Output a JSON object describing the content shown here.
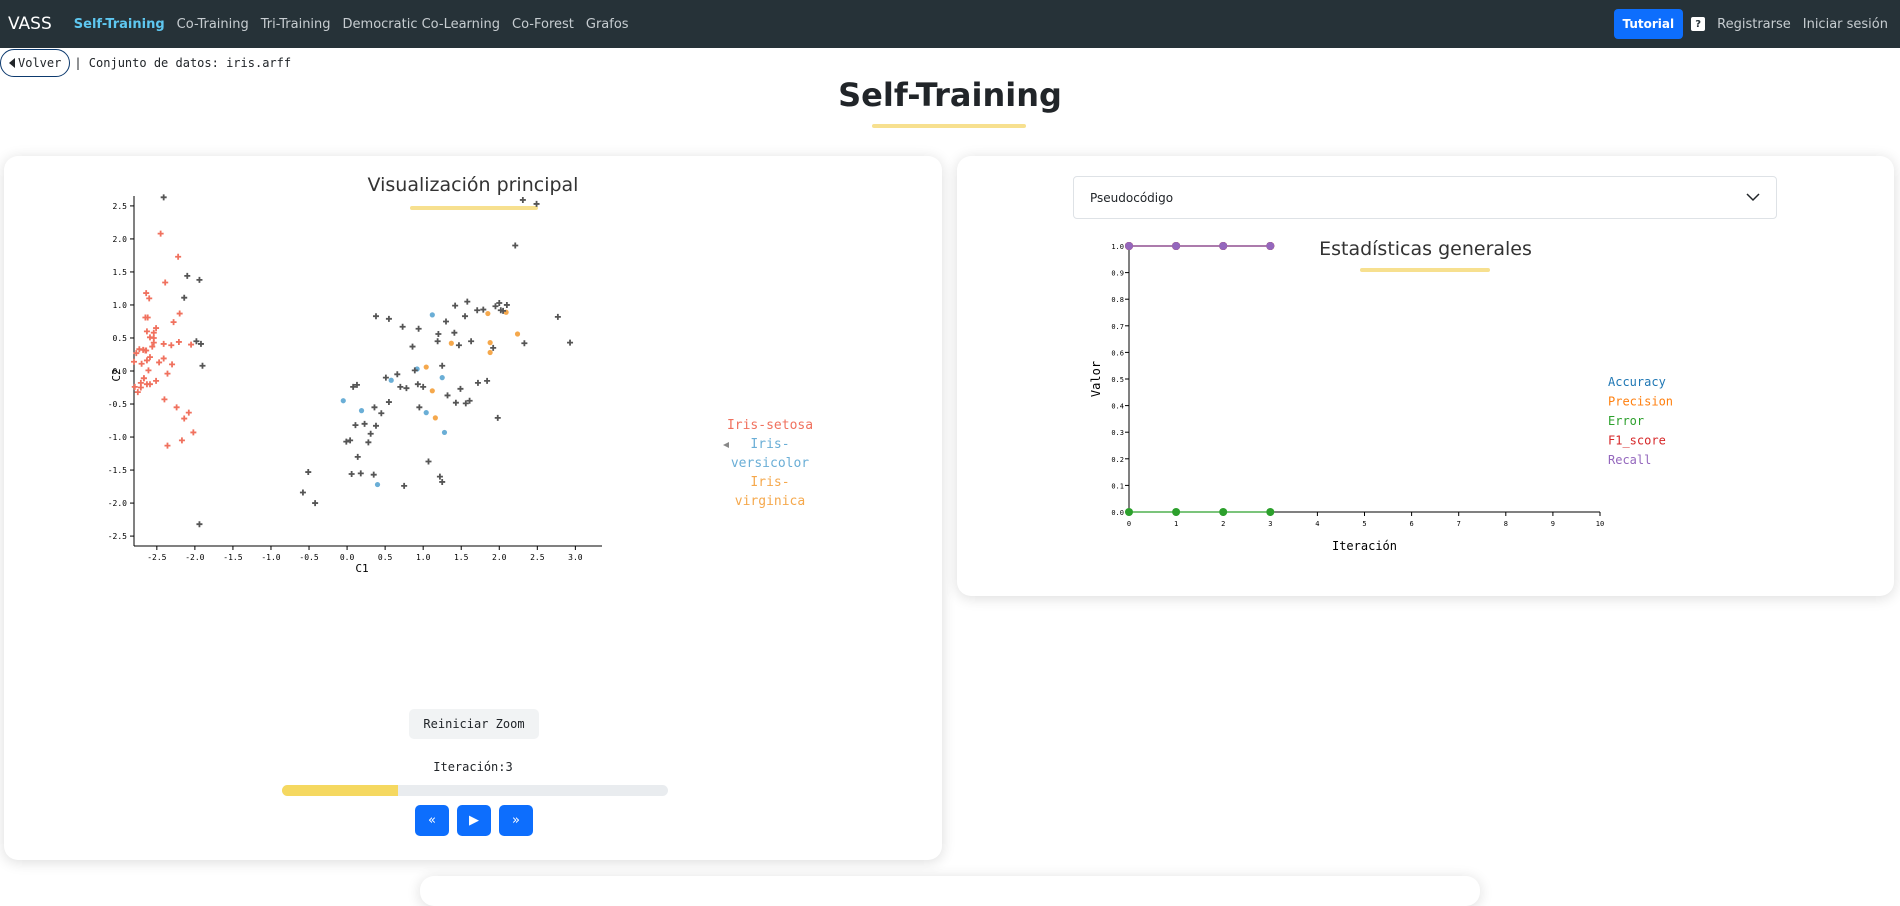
{
  "navbar": {
    "brand": "VASS",
    "links": [
      "Self-Training",
      "Co-Training",
      "Tri-Training",
      "Democratic Co-Learning",
      "Co-Forest",
      "Grafos"
    ],
    "tutorial": "Tutorial",
    "help": "?",
    "register": "Registrarse",
    "login": "Iniciar sesión"
  },
  "dataset": {
    "back": "Volver",
    "label": "| Conjunto de datos: iris.arff"
  },
  "page_title": "Self-Training",
  "left_card": {
    "title": "Visualización principal",
    "reset_zoom": "Reiniciar Zoom",
    "iteration_label": "Iteración:3",
    "progress": 0.3
  },
  "right_card": {
    "dropdown": "Pseudocódigo",
    "title": "Estadísticas generales"
  },
  "colors": {
    "setosa": "#f0715e",
    "versicolor": "#6aaed6",
    "virginica": "#f5a84c",
    "unlabeled": "#555555",
    "accuracy": "#1f77b4",
    "precision": "#ff7f0e",
    "error": "#2ca02c",
    "f1": "#d62728",
    "recall": "#9467bd",
    "accent": "#0d6efd",
    "navbar": "#263238",
    "underline": "#f7e08f"
  },
  "chart_data": [
    {
      "type": "scatter",
      "title": "",
      "xlabel": "C1",
      "ylabel": "C2",
      "xlim": [
        -2.8,
        3.35
      ],
      "ylim": [
        -2.65,
        2.65
      ],
      "xticks": [
        -2.5,
        -2.0,
        -1.5,
        -1.0,
        -0.5,
        0.0,
        0.5,
        1.0,
        1.5,
        2.0,
        2.5,
        3.0
      ],
      "yticks": [
        -2.5,
        -2.0,
        -1.5,
        -1.0,
        -0.5,
        0.0,
        0.5,
        1.0,
        1.5,
        2.0,
        2.5
      ],
      "legend": [
        "Iris-setosa",
        "Iris-",
        "versicolor",
        "Iris-",
        "virginica"
      ],
      "series": [
        {
          "name": "Iris-setosa",
          "marker": "cross",
          "points": [
            [
              -2.68,
              0.32
            ],
            [
              -2.71,
              -0.18
            ],
            [
              -2.89,
              -0.14
            ],
            [
              -2.75,
              -0.32
            ],
            [
              -2.73,
              0.33
            ],
            [
              -2.28,
              0.74
            ],
            [
              -2.82,
              -0.09
            ],
            [
              -2.63,
              0.16
            ],
            [
              -2.89,
              -0.58
            ],
            [
              -2.67,
              -0.11
            ],
            [
              -2.51,
              0.65
            ],
            [
              -2.61,
              0.01
            ],
            [
              -2.79,
              -0.24
            ],
            [
              -3.22,
              -0.51
            ],
            [
              -2.64,
              1.18
            ],
            [
              -2.39,
              1.34
            ],
            [
              -2.62,
              0.81
            ],
            [
              -2.65,
              0.31
            ],
            [
              -2.2,
              0.87
            ],
            [
              -2.59,
              0.51
            ],
            [
              -2.31,
              0.39
            ],
            [
              -2.54,
              0.43
            ],
            [
              -3.22,
              0.13
            ],
            [
              -2.3,
              0.1
            ],
            [
              -2.36,
              -0.04
            ],
            [
              -2.51,
              -0.15
            ],
            [
              -2.47,
              0.13
            ],
            [
              -2.56,
              0.37
            ],
            [
              -2.64,
              0.31
            ],
            [
              -2.63,
              -0.2
            ],
            [
              -2.59,
              -0.2
            ],
            [
              -2.41,
              0.41
            ],
            [
              -2.65,
              0.81
            ],
            [
              -2.6,
              1.1
            ],
            [
              -2.67,
              -0.11
            ],
            [
              -2.87,
              0.08
            ],
            [
              -2.63,
              0.6
            ],
            [
              -2.8,
              0.14
            ],
            [
              -2.99,
              -0.34
            ],
            [
              -2.59,
              0.21
            ],
            [
              -2.77,
              0.27
            ],
            [
              -2.85,
              -0.94
            ],
            [
              -3.0,
              -0.34
            ],
            [
              -2.41,
              0.19
            ],
            [
              -2.21,
              0.44
            ],
            [
              -2.71,
              -0.25
            ],
            [
              -2.54,
              0.5
            ],
            [
              -2.84,
              -0.23
            ],
            [
              -2.54,
              0.58
            ],
            [
              -2.7,
              0.11
            ],
            [
              -2.45,
              2.08
            ],
            [
              -2.14,
              -0.72
            ],
            [
              -2.02,
              -0.93
            ],
            [
              -2.17,
              -1.05
            ],
            [
              -2.36,
              -1.13
            ],
            [
              -2.05,
              0.4
            ],
            [
              -2.22,
              1.73
            ],
            [
              -2.08,
              -0.63
            ],
            [
              -2.4,
              -0.43
            ],
            [
              -2.24,
              -0.55
            ]
          ]
        },
        {
          "name": "Iris-versicolor",
          "marker": "dot",
          "points": [
            [
              1.12,
              0.85
            ],
            [
              0.92,
              0.03
            ],
            [
              0.58,
              -0.14
            ],
            [
              1.25,
              -0.1
            ],
            [
              0.4,
              -1.72
            ],
            [
              0.19,
              -0.6
            ],
            [
              -0.05,
              -0.45
            ],
            [
              1.28,
              -0.93
            ],
            [
              1.04,
              -0.63
            ]
          ]
        },
        {
          "name": "Iris-virginica",
          "marker": "dot",
          "points": [
            [
              1.85,
              0.87
            ],
            [
              2.09,
              0.89
            ],
            [
              1.37,
              0.42
            ],
            [
              1.88,
              0.28
            ],
            [
              2.24,
              0.56
            ],
            [
              1.12,
              -0.3
            ],
            [
              1.16,
              -0.71
            ],
            [
              1.04,
              0.06
            ],
            [
              1.88,
              0.43
            ]
          ]
        },
        {
          "name": "unlabeled",
          "marker": "cross",
          "points": [
            [
              -2.41,
              2.63
            ],
            [
              -1.94,
              -2.32
            ],
            [
              -1.9,
              0.08
            ],
            [
              -2.14,
              1.11
            ],
            [
              -1.98,
              0.45
            ],
            [
              -1.94,
              1.38
            ],
            [
              -2.1,
              1.44
            ],
            [
              -1.92,
              0.41
            ],
            [
              0.08,
              -0.24
            ],
            [
              0.13,
              -0.21
            ],
            [
              0.51,
              -0.1
            ],
            [
              0.7,
              -0.24
            ],
            [
              0.55,
              -0.47
            ],
            [
              0.36,
              -0.55
            ],
            [
              0.23,
              -0.8
            ],
            [
              0.04,
              -1.05
            ],
            [
              0.38,
              -0.83
            ],
            [
              -0.01,
              -1.07
            ],
            [
              0.18,
              -1.55
            ],
            [
              0.14,
              -1.3
            ],
            [
              0.28,
              -1.08
            ],
            [
              0.11,
              -0.82
            ],
            [
              0.31,
              -0.95
            ],
            [
              0.45,
              -0.64
            ],
            [
              -0.58,
              -1.84
            ],
            [
              -0.51,
              -1.53
            ],
            [
              -0.42,
              -2.0
            ],
            [
              0.75,
              -1.74
            ],
            [
              0.06,
              -1.56
            ],
            [
              0.35,
              -1.57
            ],
            [
              1.07,
              -1.37
            ],
            [
              1.22,
              -1.6
            ],
            [
              1.25,
              -1.68
            ],
            [
              1.43,
              -0.48
            ],
            [
              1.56,
              -0.49
            ],
            [
              1.32,
              -0.37
            ],
            [
              1.61,
              -0.45
            ],
            [
              1.84,
              -0.15
            ],
            [
              1.98,
              -0.71
            ],
            [
              1.72,
              -0.18
            ],
            [
              1.49,
              -0.27
            ],
            [
              1.25,
              0.08
            ],
            [
              1.0,
              -0.24
            ],
            [
              0.95,
              -0.55
            ],
            [
              0.66,
              -0.05
            ],
            [
              0.78,
              -0.26
            ],
            [
              0.93,
              -0.2
            ],
            [
              0.89,
              0.01
            ],
            [
              0.73,
              0.67
            ],
            [
              0.86,
              0.37
            ],
            [
              0.55,
              0.79
            ],
            [
              0.94,
              0.64
            ],
            [
              0.38,
              0.83
            ],
            [
              1.2,
              0.56
            ],
            [
              1.41,
              0.58
            ],
            [
              1.47,
              0.39
            ],
            [
              1.63,
              0.45
            ],
            [
              1.71,
              0.92
            ],
            [
              1.42,
              0.99
            ],
            [
              1.55,
              0.83
            ],
            [
              1.79,
              0.93
            ],
            [
              1.92,
              0.35
            ],
            [
              2.0,
              1.03
            ],
            [
              2.05,
              0.91
            ],
            [
              2.1,
              1.0
            ],
            [
              2.21,
              1.9
            ],
            [
              2.31,
              2.59
            ],
            [
              2.49,
              2.53
            ],
            [
              2.33,
              0.42
            ],
            [
              2.77,
              0.82
            ],
            [
              2.93,
              0.43
            ],
            [
              1.58,
              1.05
            ],
            [
              1.3,
              0.75
            ],
            [
              1.19,
              0.45
            ],
            [
              1.95,
              0.98
            ],
            [
              2.02,
              0.92
            ]
          ]
        }
      ]
    },
    {
      "type": "line",
      "title": "",
      "xlabel": "Iteración",
      "ylabel": "Valor",
      "xlim": [
        0,
        10
      ],
      "ylim": [
        0,
        1.0
      ],
      "xticks": [
        0,
        1,
        2,
        3,
        4,
        5,
        6,
        7,
        8,
        9,
        10
      ],
      "yticks": [
        0.0,
        0.1,
        0.2,
        0.3,
        0.4,
        0.5,
        0.6,
        0.7,
        0.8,
        0.9,
        1.0
      ],
      "legend_position": "right",
      "x": [
        0,
        1,
        2,
        3
      ],
      "series": [
        {
          "name": "Accuracy",
          "values": [
            1.0,
            1.0,
            1.0,
            1.0
          ]
        },
        {
          "name": "Precision",
          "values": [
            1.0,
            1.0,
            1.0,
            1.0
          ]
        },
        {
          "name": "Error",
          "values": [
            0.0,
            0.0,
            0.0,
            0.0
          ]
        },
        {
          "name": "F1_score",
          "values": [
            1.0,
            1.0,
            1.0,
            1.0
          ]
        },
        {
          "name": "Recall",
          "values": [
            1.0,
            1.0,
            1.0,
            1.0
          ]
        }
      ]
    }
  ]
}
